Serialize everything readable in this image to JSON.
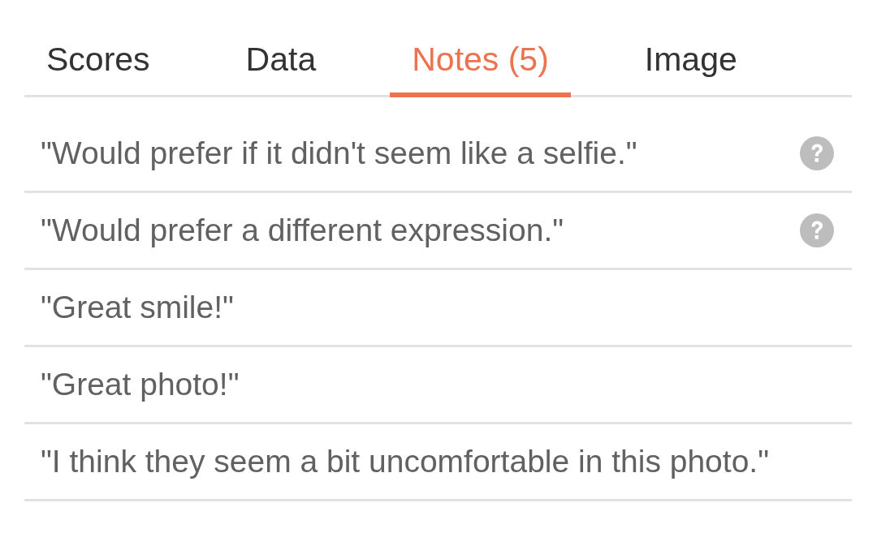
{
  "tabs": [
    {
      "label": "Scores",
      "selected": false
    },
    {
      "label": "Data",
      "selected": false
    },
    {
      "label": "Notes (5)",
      "selected": true
    },
    {
      "label": "Image",
      "selected": false
    }
  ],
  "notes": [
    {
      "text": "\"Would prefer if it didn't seem like a selfie.\"",
      "help": true
    },
    {
      "text": "\"Would prefer a different expression.\"",
      "help": true
    },
    {
      "text": "\"Great smile!\"",
      "help": false
    },
    {
      "text": "\"Great photo!\"",
      "help": false
    },
    {
      "text": "\"I think they seem a bit uncomfortable in this photo.\"",
      "help": false
    }
  ]
}
